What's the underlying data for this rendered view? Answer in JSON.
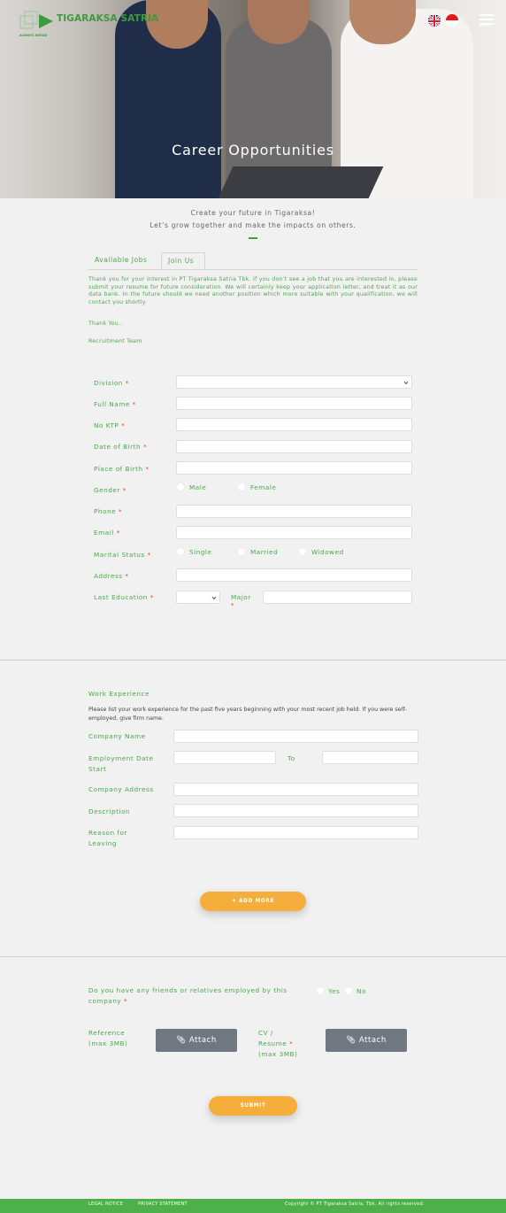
{
  "header": {
    "logo_text": "TIGARAKSA SATRIA",
    "logo_tagline": "ALWAYS AHEAD",
    "menu_label": "MENU",
    "hero_title": "Career Opportunities"
  },
  "intro": {
    "line1": "Create your future in Tigaraksa!",
    "line2": "Let’s grow together and make the impacts on others."
  },
  "tabs": [
    {
      "label": "Available Jobs",
      "active": false
    },
    {
      "label": "Join Us",
      "active": true
    }
  ],
  "message": {
    "body": "Thank you for your interest in PT Tigaraksa Satria Tbk. If you don’t see a job that you are interested in, please submit your resume for future consideration. We will certainly keep your application letter, and treat it as our data bank. In the future should we need another position which more suitable with your qualification, we will contact you shortly.",
    "thanks": "Thank You..",
    "signature": "Recruitment Team"
  },
  "form": {
    "division": "Division",
    "full_name": "Full Name",
    "no_ktp": "No KTP",
    "date_of_birth": "Date of Birth",
    "place_of_birth": "Place of Birth",
    "gender": "Gender",
    "gender_options": [
      "Male",
      "Female"
    ],
    "phone": "Phone",
    "email": "Email",
    "marital_status": "Marital Status",
    "marital_options": [
      "Single",
      "Married",
      "Widowed"
    ],
    "address": "Address",
    "last_education": "Last Education",
    "major": "Major",
    "required_mark": "*"
  },
  "work_experience": {
    "title": "Work Experience",
    "instructions": "Please list your work experience for the past five years beginning with your most recent job held. If you were self-employed, give firm name.",
    "company_name": "Company Name",
    "employment_date_start": "Employment Date Start",
    "to": "To",
    "company_address": "Company Address",
    "description": "Description",
    "reason_for_leaving": "Reason for Leaving",
    "add_more_button": "+ ADD MORE"
  },
  "additional": {
    "friends_question": "Do you have any friends or relatives employed by this company",
    "yes": "Yes",
    "no": "No",
    "reference_label": "Reference (max 3MB)",
    "cv_label": "CV / Resume",
    "cv_limit": "(max 3MB)",
    "attach_button": "Attach",
    "submit_button": "SUBMIT"
  },
  "footer": {
    "legal_notice": "LEGAL NOTICE",
    "privacy_statement": "PRIVACY STATEMENT",
    "copyright": "Copyright © PT Tigaraksa Satria, Tbk. All rights reserved."
  },
  "colors": {
    "brand_green": "#4aa84a",
    "accent_orange": "#f5ad3b",
    "attach_gray": "#707780",
    "required_red": "#e23c3c"
  }
}
